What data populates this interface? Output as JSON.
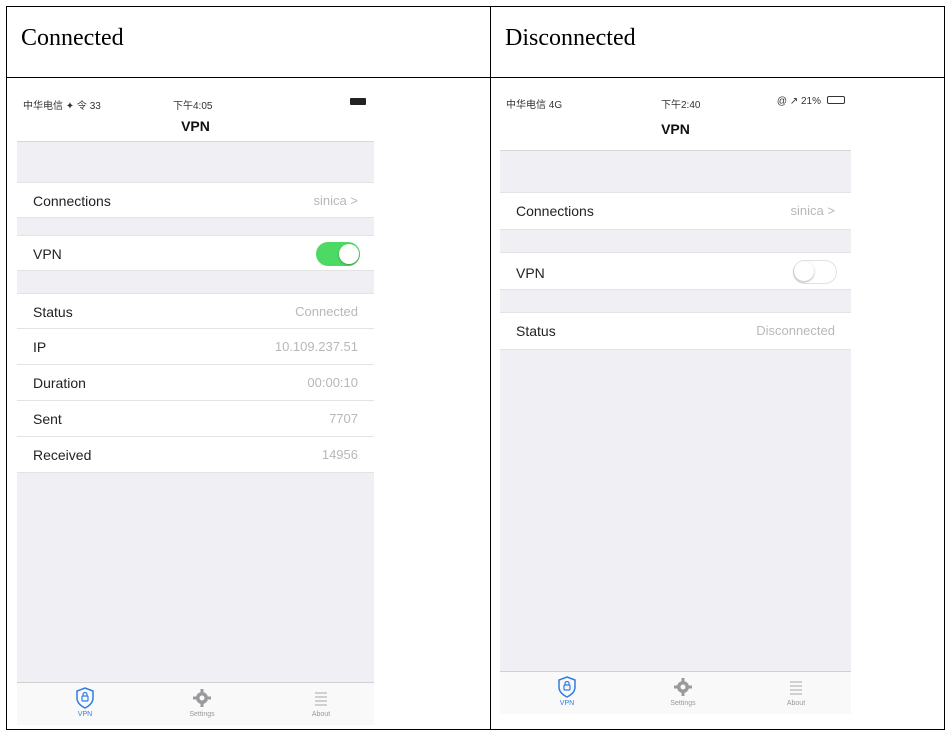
{
  "headers": {
    "left": "Connected",
    "right": "Disconnected"
  },
  "connected": {
    "status_bar": {
      "left": "中华电信 ✦ 令 33",
      "time": "下午4:05"
    },
    "nav_title": "VPN",
    "connections": {
      "label": "Connections",
      "value": "sinica >"
    },
    "vpn": {
      "label": "VPN",
      "toggle_on": true
    },
    "rows": [
      {
        "label": "Status",
        "value": "Connected"
      },
      {
        "label": "IP",
        "value": "10.109.237.51"
      },
      {
        "label": "Duration",
        "value": "00:00:10"
      },
      {
        "label": "Sent",
        "value": "7707"
      },
      {
        "label": "Received",
        "value": "14956"
      }
    ],
    "tabs": [
      {
        "label": "VPN",
        "icon": "shield-icon"
      },
      {
        "label": "Settings",
        "icon": "gear-icon"
      },
      {
        "label": "About",
        "icon": "list-icon"
      }
    ]
  },
  "disconnected": {
    "status_bar": {
      "left": "中华电信 4G",
      "time": "下午2:40",
      "right": "@ ↗ 21%"
    },
    "nav_title": "VPN",
    "connections": {
      "label": "Connections",
      "value": "sinica >"
    },
    "vpn": {
      "label": "VPN",
      "toggle_on": false
    },
    "rows": [
      {
        "label": "Status",
        "value": "Disconnected"
      }
    ],
    "tabs": [
      {
        "label": "VPN",
        "icon": "shield-icon"
      },
      {
        "label": "Settings",
        "icon": "gear-icon"
      },
      {
        "label": "About",
        "icon": "list-icon"
      }
    ]
  },
  "colors": {
    "toggle_on": "#4cd964",
    "tab_active": "#2e7de1",
    "background": "#efeff4"
  }
}
